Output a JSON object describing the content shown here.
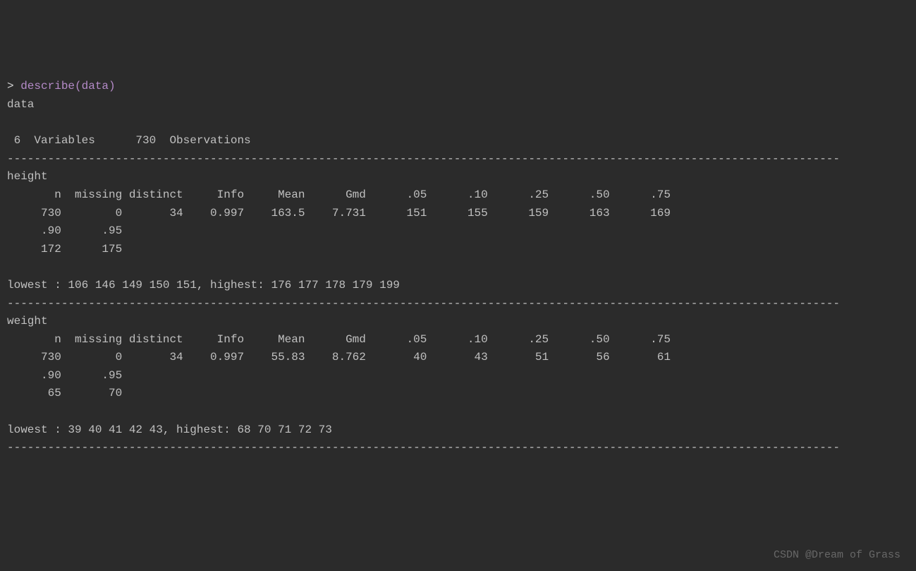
{
  "prompt": "> ",
  "command": "describe(data)",
  "output": {
    "title": "data",
    "summary": " 6  Variables      730  Observations",
    "divider": "---------------------------------------------------------------------------------------------------------------------------",
    "vars": [
      {
        "name": "height",
        "row1_headers": "       n  missing distinct     Info     Mean      Gmd      .05      .10      .25      .50      .75",
        "row1_values": "     730        0       34    0.997    163.5    7.731      151      155      159      163      169",
        "row2_headers": "     .90      .95",
        "row2_values": "     172      175",
        "extremes": "lowest : 106 146 149 150 151, highest: 176 177 178 179 199"
      },
      {
        "name": "weight",
        "row1_headers": "       n  missing distinct     Info     Mean      Gmd      .05      .10      .25      .50      .75",
        "row1_values": "     730        0       34    0.997    55.83    8.762       40       43       51       56       61",
        "row2_headers": "     .90      .95",
        "row2_values": "      65       70",
        "extremes": "lowest : 39 40 41 42 43, highest: 68 70 71 72 73"
      }
    ]
  },
  "watermark": "CSDN @Dream of Grass"
}
